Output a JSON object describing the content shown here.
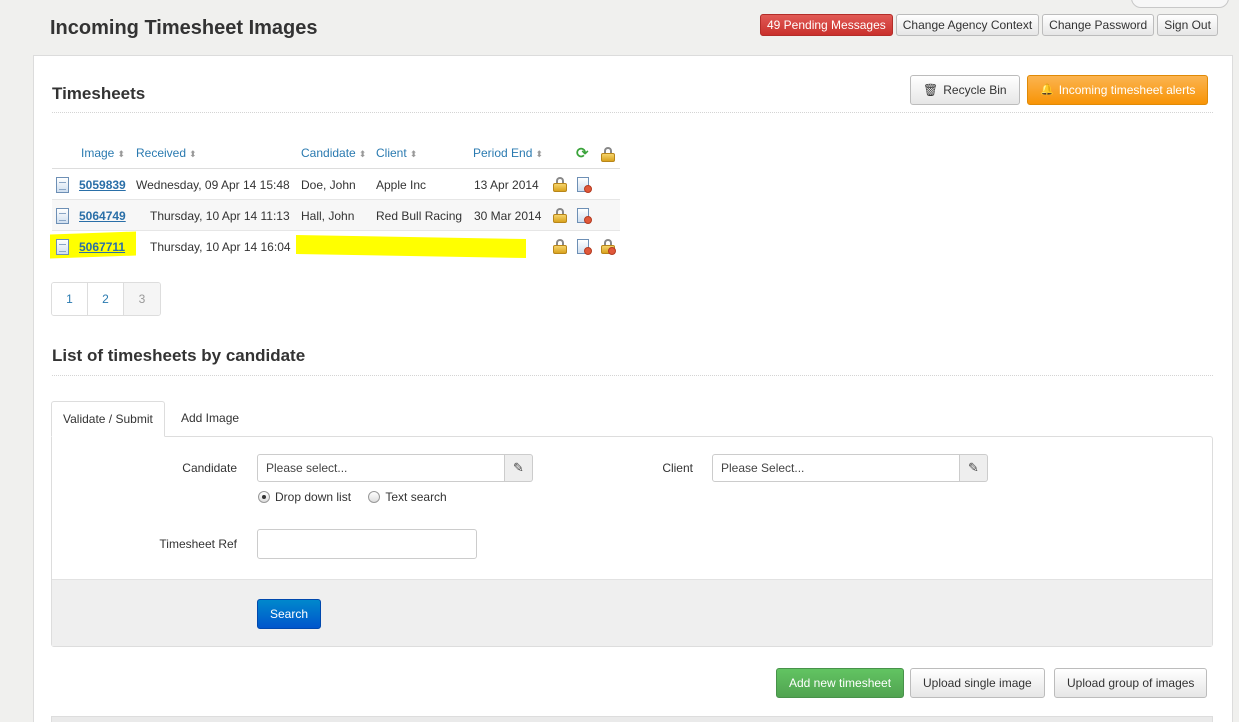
{
  "header": {
    "title": "Incoming Timesheet Images",
    "pending_messages": "49 Pending Messages",
    "change_agency": "Change Agency Context",
    "change_password": "Change Password",
    "sign_out": "Sign Out"
  },
  "timesheets": {
    "heading": "Timesheets",
    "recycle_bin": "Recycle Bin",
    "alerts": "Incoming timesheet alerts",
    "columns": [
      "Image",
      "Received",
      "Candidate",
      "Client",
      "Period End"
    ],
    "rows": [
      {
        "image": "5059839",
        "received": "Wednesday, 09 Apr 14 15:48",
        "candidate": "Doe, John",
        "client": "Apple Inc",
        "period_end": "13 Apr 2014"
      },
      {
        "image": "5064749",
        "received": "Thursday, 10 Apr 14 11:13",
        "candidate": "Hall, John",
        "client": "Red Bull Racing",
        "period_end": "30 Mar 2014"
      },
      {
        "image": "5067711",
        "received": "Thursday, 10 Apr 14 16:04",
        "candidate": "",
        "client": "",
        "period_end": ""
      }
    ],
    "pages": [
      "1",
      "2",
      "3"
    ]
  },
  "list_by_candidate": {
    "heading": "List of timesheets by candidate",
    "tabs": [
      "Validate / Submit",
      "Add Image"
    ],
    "candidate_label": "Candidate",
    "candidate_value": "Please select...",
    "radio_dropdown": "Drop down list",
    "radio_text": "Text search",
    "client_label": "Client",
    "client_value": "Please Select...",
    "ref_label": "Timesheet Ref",
    "ref_value": "",
    "search": "Search"
  },
  "footer_actions": {
    "add_new": "Add new timesheet",
    "upload_single": "Upload single image",
    "upload_group": "Upload group of images"
  },
  "colors": {
    "accent": "#2a7ab0",
    "danger": "#c9302c",
    "warning": "#f89406",
    "success": "#51a351",
    "highlight": "#ffff00"
  }
}
